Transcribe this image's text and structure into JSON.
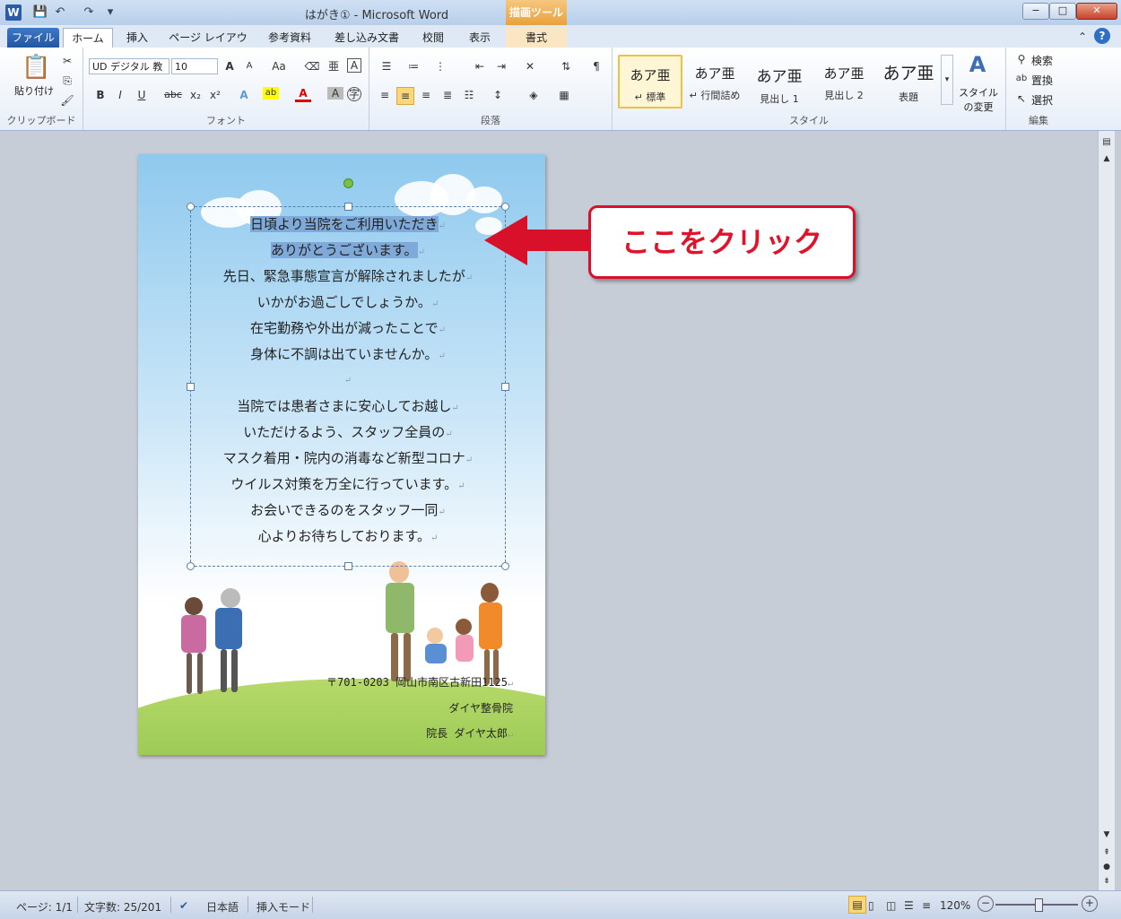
{
  "window": {
    "title": "はがき① - Microsoft Word",
    "context_tool": "描画ツール",
    "controls": {
      "minimize": "−",
      "maximize": "□",
      "close": "✕"
    }
  },
  "qat": {
    "app_icon": "W",
    "save": "💾",
    "undo": "↶",
    "redo": "↷",
    "customize": "▾"
  },
  "tabs": [
    {
      "label": "ファイル"
    },
    {
      "label": "ホーム"
    },
    {
      "label": "挿入"
    },
    {
      "label": "ページ レイアウト"
    },
    {
      "label": "参考資料"
    },
    {
      "label": "差し込み文書"
    },
    {
      "label": "校閲"
    },
    {
      "label": "表示"
    },
    {
      "label": "書式"
    }
  ],
  "ribbon": {
    "clipboard": {
      "paste": "貼り付け",
      "label": "クリップボード"
    },
    "font": {
      "name": "UD デジタル 教",
      "size": "10",
      "label": "フォント",
      "bold": "B",
      "italic": "I",
      "underline": "U",
      "strike": "abc",
      "sub": "x₂",
      "sup": "x²",
      "grow": "A",
      "shrink": "A",
      "case": "Aa"
    },
    "paragraph": {
      "label": "段落"
    },
    "styles": {
      "label": "スタイル",
      "items": [
        {
          "big": "あア亜",
          "small": "↵ 標準"
        },
        {
          "big": "あア亜",
          "small": "↵ 行間詰め"
        },
        {
          "big": "あア亜",
          "small": "見出し 1"
        },
        {
          "big": "あア亜",
          "small": "見出し 2"
        },
        {
          "big": "あア亜",
          "small": "表題"
        }
      ],
      "change": "スタイルの変更"
    },
    "editing": {
      "label": "編集",
      "find": "検索",
      "replace": "置換",
      "select": "選択"
    }
  },
  "document": {
    "lines": [
      "日頃より当院をご利用いただき",
      "ありがとうございます。",
      "先日、緊急事態宣言が解除されましたが",
      "いかがお過ごしでしょうか。",
      "在宅勤務や外出が減ったことで",
      "身体に不調は出ていませんか。",
      "",
      "当院では患者さまに安心してお越し",
      "いただけるよう、スタッフ全員の",
      "マスク着用・院内の消毒など新型コロナ",
      "ウイルス対策を万全に行っています。",
      "お会いできるのをスタッフ一同",
      "心よりお待ちしております。"
    ],
    "para_mark": "↵",
    "address": "〒701-0203 岡山市南区古新田1125",
    "clinic": "ダイヤ整骨院",
    "director": "院長 ダイヤ太郎"
  },
  "callout": {
    "text": "ここをクリック",
    "color": "#e0132a"
  },
  "status": {
    "page": "ページ: 1/1",
    "words": "文字数: 25/201",
    "language": "日本語",
    "mode": "挿入モード",
    "zoom": "120%",
    "zoom_minus": "−",
    "zoom_plus": "+"
  }
}
